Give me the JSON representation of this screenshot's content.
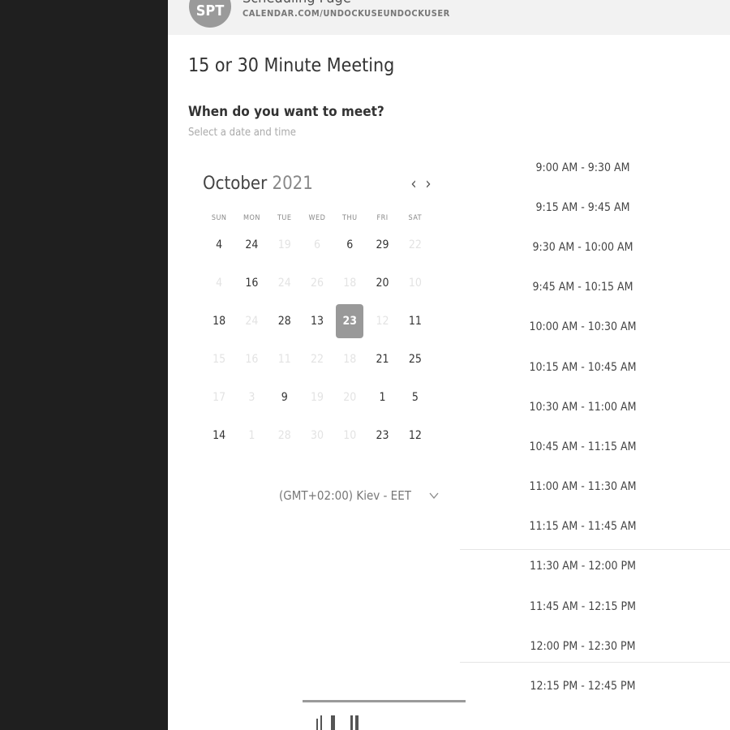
{
  "header": {
    "avatar_initials": "SPT",
    "page_title": "Scheduling Page",
    "url": "CALENDAR.COM/UNDOCKUSEUNDOCKUSER"
  },
  "meeting": {
    "title": "15 or 30 Minute Meeting",
    "question": "When do you want to meet?",
    "hint": "Select a date and time"
  },
  "calendar": {
    "month": "October",
    "year": "2021",
    "prev_icon": "chevron-left-icon",
    "next_icon": "chevron-right-icon",
    "weekdays": [
      "SUN",
      "MON",
      "TUE",
      "WED",
      "THU",
      "FRI",
      "SAT"
    ],
    "weeks": [
      [
        {
          "d": "4",
          "a": true
        },
        {
          "d": "24",
          "a": true
        },
        {
          "d": "19",
          "a": false
        },
        {
          "d": "6",
          "a": false
        },
        {
          "d": "6",
          "a": true
        },
        {
          "d": "29",
          "a": true
        },
        {
          "d": "22",
          "a": false
        }
      ],
      [
        {
          "d": "4",
          "a": false
        },
        {
          "d": "16",
          "a": true
        },
        {
          "d": "24",
          "a": false
        },
        {
          "d": "26",
          "a": false
        },
        {
          "d": "18",
          "a": false
        },
        {
          "d": "20",
          "a": true
        },
        {
          "d": "10",
          "a": false
        }
      ],
      [
        {
          "d": "18",
          "a": true
        },
        {
          "d": "24",
          "a": false
        },
        {
          "d": "28",
          "a": true
        },
        {
          "d": "13",
          "a": true
        },
        {
          "d": "23",
          "a": true,
          "selected": true
        },
        {
          "d": "12",
          "a": false
        },
        {
          "d": "11",
          "a": true
        }
      ],
      [
        {
          "d": "15",
          "a": false
        },
        {
          "d": "16",
          "a": false
        },
        {
          "d": "11",
          "a": false
        },
        {
          "d": "22",
          "a": false
        },
        {
          "d": "18",
          "a": false
        },
        {
          "d": "21",
          "a": true
        },
        {
          "d": "25",
          "a": true
        }
      ],
      [
        {
          "d": "17",
          "a": false
        },
        {
          "d": "3",
          "a": false
        },
        {
          "d": "9",
          "a": true
        },
        {
          "d": "19",
          "a": false
        },
        {
          "d": "20",
          "a": false
        },
        {
          "d": "1",
          "a": true
        },
        {
          "d": "5",
          "a": true
        }
      ],
      [
        {
          "d": "14",
          "a": true
        },
        {
          "d": "1",
          "a": false
        },
        {
          "d": "28",
          "a": false
        },
        {
          "d": "30",
          "a": false
        },
        {
          "d": "10",
          "a": false
        },
        {
          "d": "23",
          "a": true
        },
        {
          "d": "12",
          "a": true
        }
      ]
    ]
  },
  "timezone": {
    "label": "(GMT+02:00) Kiev - EET",
    "icon": "chevron-down-icon"
  },
  "time_slots": [
    "9:00 AM - 9:30 AM",
    "9:15 AM - 9:45 AM",
    "9:30 AM - 10:00 AM",
    "9:45 AM - 10:15 AM",
    "10:00 AM - 10:30 AM",
    "10:15 AM - 10:45 AM",
    "10:30 AM - 11:00 AM",
    "10:45 AM - 11:15 AM",
    "11:00 AM - 11:30 AM",
    "11:15 AM - 11:45 AM",
    "11:30 AM - 12:00 PM",
    "11:45 AM - 12:15 PM",
    "12:00 PM - 12:30 PM",
    "12:15 PM - 12:45 PM"
  ],
  "colors": {
    "sidebar": "#1f1f1f",
    "header_bg": "#f2f2f2",
    "selected_day": "#999999"
  }
}
